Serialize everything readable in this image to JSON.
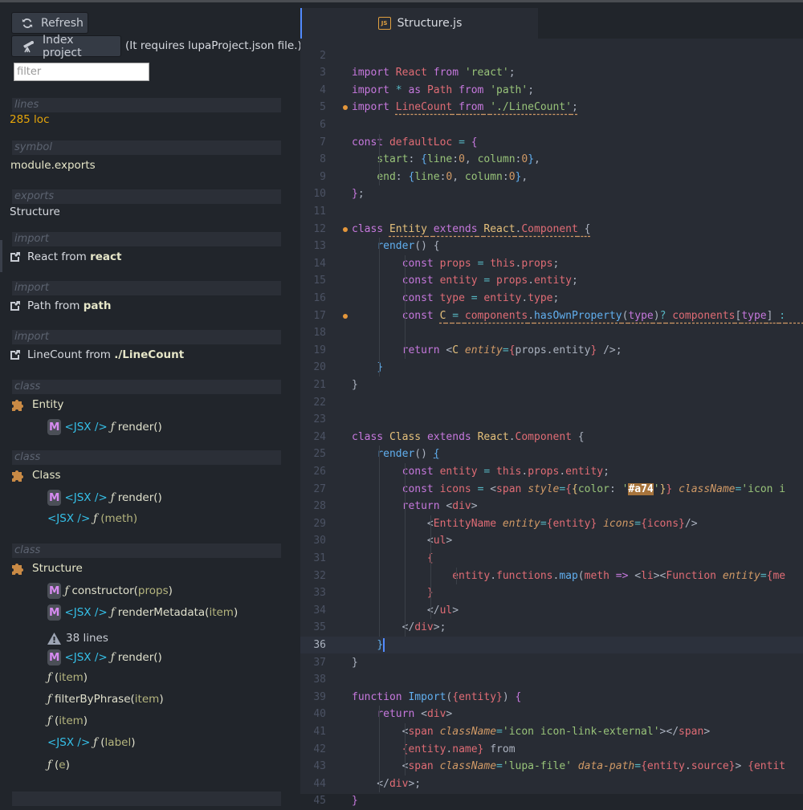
{
  "sidebar": {
    "refresh_label": "Refresh",
    "index_label": "Index project",
    "index_note": "(It requires lupaProject.json file.)",
    "filter_placeholder": "filter",
    "filter_value": "",
    "sections": [
      {
        "head": "lines",
        "value": "285 loc"
      },
      {
        "head": "symbol",
        "value": "module.exports"
      },
      {
        "head": "exports",
        "value": "Structure"
      },
      {
        "head": "import",
        "name": "React",
        "from_word": "from",
        "source": "react"
      },
      {
        "head": "import",
        "name": "Path",
        "from_word": "from",
        "source": "path"
      },
      {
        "head": "import",
        "name": "LineCount",
        "from_word": "from",
        "source": "./LineCount"
      },
      {
        "head": "class",
        "name": "Entity"
      },
      {
        "head": "class",
        "name": "Class"
      },
      {
        "head": "class",
        "name": "Structure"
      }
    ],
    "badge_m": "M",
    "jsx_label": "<JSX />",
    "f_symbol": "ƒ",
    "entity_members": [
      {
        "name": "render",
        "params": "()"
      }
    ],
    "class_members": [
      {
        "name": "render",
        "params": "()"
      },
      {
        "name": "",
        "params": "(meth)"
      }
    ],
    "structure_members": [
      {
        "name": "constructor",
        "param": "props"
      },
      {
        "name": "renderMetadata",
        "param": "item"
      },
      {
        "name": "render",
        "params": "()"
      },
      {
        "name": "",
        "param": "item"
      },
      {
        "name": "filterByPhrase",
        "param": "item"
      },
      {
        "name": "",
        "param": "item"
      },
      {
        "name": "",
        "param": "label"
      },
      {
        "name": "",
        "param": "e"
      }
    ],
    "warning": "38 lines"
  },
  "editor": {
    "tab_title": "Structure.js",
    "tab_icon": "JS",
    "current_line": 36,
    "highlight_color": "#a74"
  }
}
